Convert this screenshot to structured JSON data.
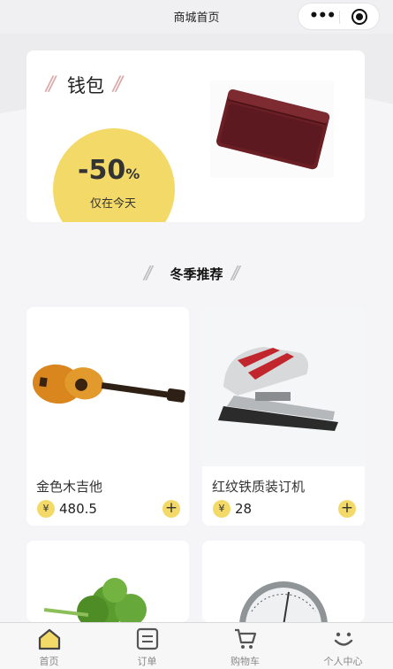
{
  "navbar": {
    "title": "商城首页",
    "menu_icon": "more-dots-icon",
    "close_icon": "target-icon"
  },
  "banner": {
    "title": "钱包",
    "discount_value": "-50",
    "discount_unit": "%",
    "discount_sub": "仅在今天",
    "accent_color": "#f3d968"
  },
  "section": {
    "title": "冬季推荐"
  },
  "products": [
    {
      "name": "金色木吉他",
      "currency": "¥",
      "price": "480.5",
      "icon": "guitar-image"
    },
    {
      "name": "红纹铁质装订机",
      "currency": "¥",
      "price": "28",
      "icon": "stapler-image"
    },
    {
      "name": "",
      "currency": "",
      "price": "",
      "icon": "parsley-image"
    },
    {
      "name": "",
      "currency": "",
      "price": "",
      "icon": "gauge-image"
    }
  ],
  "tabbar": {
    "items": [
      {
        "label": "首页",
        "icon": "home-icon",
        "active": true
      },
      {
        "label": "订单",
        "icon": "order-icon",
        "active": false
      },
      {
        "label": "购物车",
        "icon": "cart-icon",
        "active": false
      },
      {
        "label": "个人中心",
        "icon": "smile-icon",
        "active": false
      }
    ]
  }
}
